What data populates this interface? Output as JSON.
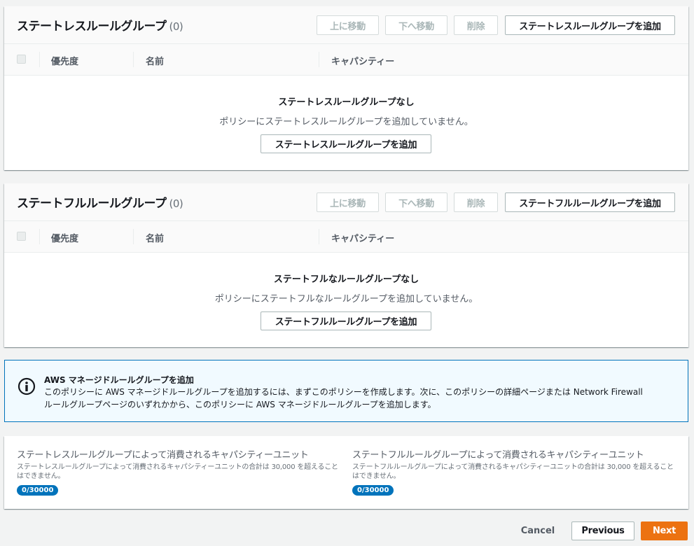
{
  "stateless": {
    "title": "ステートレスルールグループ",
    "count": "(0)",
    "btn_up": "上に移動",
    "btn_down": "下へ移動",
    "btn_delete": "削除",
    "btn_add": "ステートレスルールグループを追加",
    "columns": [
      "優先度",
      "名前",
      "キャパシティー"
    ],
    "empty_title": "ステートレスルールグループなし",
    "empty_desc": "ポリシーにステートレスルールグループを追加していません。",
    "empty_add": "ステートレスルールグループを追加"
  },
  "stateful": {
    "title": "ステートフルルールグループ",
    "count": "(0)",
    "btn_up": "上に移動",
    "btn_down": "下へ移動",
    "btn_delete": "削除",
    "btn_add": "ステートフルルールグループを追加",
    "columns": [
      "優先度",
      "名前",
      "キャパシティー"
    ],
    "empty_title": "ステートフルなルールグループなし",
    "empty_desc": "ポリシーにステートフルなルールグループを追加していません。",
    "empty_add": "ステートフルルールグループを追加"
  },
  "info": {
    "icon": "info-icon",
    "title": "AWS マネージドルールグループを追加",
    "line1": "このポリシーに AWS マネージドルールグループを追加するには、まずこのポリシーを作成します。次に、このポリシーの詳細ページまたは Network Firewall",
    "line2": "ルールグループページのいずれかから、このポリシーに AWS マネージドルールグループを追加します。",
    "accent": "#0073bb"
  },
  "capacity": {
    "stateless_label": "ステートレスルールグループによって消費されるキャパシティーユニット",
    "stateless_desc": "ステートレスルールグループによって消費されるキャパシティーユニットの合計は 30,000 を超えることはできません。",
    "stateless_value": "0/30000",
    "stateful_label": "ステートフルルールグループによって消費されるキャパシティーユニット",
    "stateful_desc": "ステートフルルールグループによって消費されるキャパシティーユニットの合計は 30,000 を超えることはできません。",
    "stateful_value": "0/30000"
  },
  "footer": {
    "cancel": "Cancel",
    "previous": "Previous",
    "next": "Next",
    "primary_color": "#ec7211"
  }
}
